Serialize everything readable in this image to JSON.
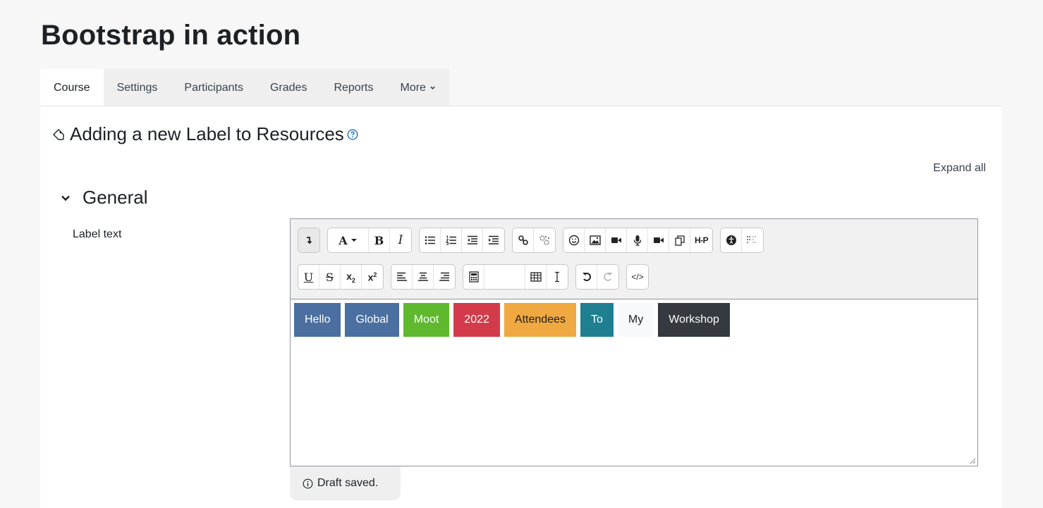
{
  "page": {
    "title": "Bootstrap in action"
  },
  "nav": {
    "tabs": [
      {
        "label": "Course",
        "active": true
      },
      {
        "label": "Settings"
      },
      {
        "label": "Participants"
      },
      {
        "label": "Grades"
      },
      {
        "label": "Reports"
      },
      {
        "label": "More",
        "icon": "chevron-down-icon"
      }
    ]
  },
  "form": {
    "heading": "Adding a new Label to Resources",
    "heading_icon": "tag-icon",
    "help_icon": "help-icon",
    "expand_all": "Expand all",
    "section": "General",
    "field_label": "Label text"
  },
  "editor": {
    "toolbar_row1": [
      "show-more-icon",
      "font-color-icon",
      "bold-icon",
      "italic-icon",
      "unordered-list-icon",
      "ordered-list-icon",
      "outdent-icon",
      "indent-icon",
      "link-icon",
      "unlink-icon",
      "emoji-icon",
      "image-icon",
      "media-icon",
      "record-audio-icon",
      "record-video-icon",
      "manage-files-icon",
      "h5p-icon",
      "accessibility-checker-icon",
      "screenreader-helper-icon"
    ],
    "toolbar_row2": [
      "underline-icon",
      "strikethrough-icon",
      "subscript-icon",
      "superscript-icon",
      "align-left-icon",
      "align-center-icon",
      "align-right-icon",
      "equation-icon",
      "character-map-icon",
      "table-icon",
      "clear-formatting-icon",
      "undo-icon",
      "redo-icon",
      "html-source-icon"
    ],
    "glyphs": {
      "bold": "B",
      "italic": "I",
      "underline": "U",
      "strike": "S",
      "h5p": "H-P",
      "html": "</>"
    },
    "content_words": [
      {
        "text": "Hello",
        "color": "#4a6fa0"
      },
      {
        "text": "Global",
        "color": "#4a6fa0"
      },
      {
        "text": "Moot",
        "color": "#5fb82e"
      },
      {
        "text": "2022",
        "color": "#d33b4a"
      },
      {
        "text": "Attendees",
        "color": "#f0a840"
      },
      {
        "text": "To",
        "color": "#1f7f91"
      },
      {
        "text": "My",
        "color": "#f8f9fa"
      },
      {
        "text": "Workshop",
        "color": "#343a40"
      }
    ]
  },
  "status": {
    "draft": "Draft saved.",
    "icon": "info-icon"
  }
}
